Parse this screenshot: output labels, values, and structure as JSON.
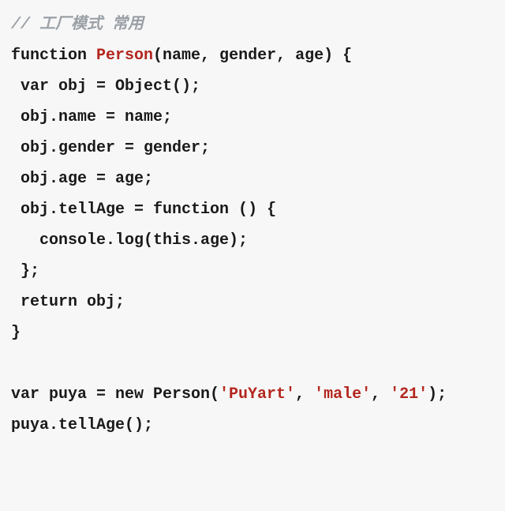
{
  "code": {
    "comment": "// 工厂模式 常用",
    "l1_kw": "function",
    "l1_fn": "Person",
    "l1_rest": "(name, gender, age) {",
    "l2": " var obj = Object();",
    "l3": " obj.name = name;",
    "l4": " obj.gender = gender;",
    "l5": " obj.age = age;",
    "l6": " obj.tellAge = function () {",
    "l7": "   console.log(this.age);",
    "l8": " };",
    "l9": " return obj;",
    "l10": "}",
    "l12a": "var puya = new Person(",
    "l12s1": "'PuYart'",
    "l12b": ", ",
    "l12s2": "'male'",
    "l12c": ", ",
    "l13s": "'21'",
    "l13a": ");",
    "l14": "puya.tellAge();"
  }
}
